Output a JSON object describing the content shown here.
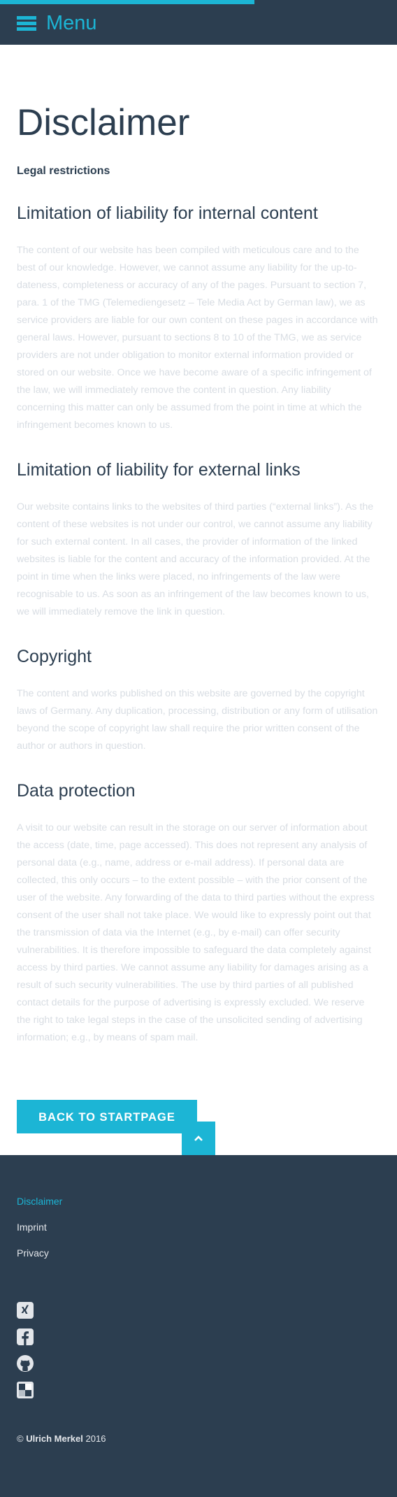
{
  "header": {
    "menu_label": "Menu",
    "menu_icon": "hamburger-icon",
    "accent_color": "#1cb5d5",
    "background_color": "#2c3e50"
  },
  "page": {
    "title": "Disclaimer",
    "subtitle": "Legal restrictions"
  },
  "sections": [
    {
      "heading": "Limitation of liability for internal content",
      "text": "The content of our website has been compiled with meticulous care and to the best of our knowledge. However, we cannot assume any liability for the up-to-dateness, completeness or accuracy of any of the pages. Pursuant to section 7, para. 1 of the TMG (Telemediengesetz – Tele Media Act by German law), we as service providers are liable for our own content on these pages in accordance with general laws. However, pursuant to sections 8 to 10 of the TMG, we as service providers are not under obligation to monitor external information provided or stored on our website. Once we have become aware of a specific infringement of the law, we will immediately remove the content in question. Any liability concerning this matter can only be assumed from the point in time at which the infringement becomes known to us."
    },
    {
      "heading": "Limitation of liability for external links",
      "text": "Our website contains links to the websites of third parties (“external links”). As the content of these websites is not under our control, we cannot assume any liability for such external content. In all cases, the provider of information of the linked websites is liable for the content and accuracy of the information provided. At the point in time when the links were placed, no infringements of the law were recognisable to us. As soon as an infringement of the law becomes known to us, we will immediately remove the link in question."
    },
    {
      "heading": "Copyright",
      "text": "The content and works published on this website are governed by the copyright laws of Germany. Any duplication, processing, distribution or any form of utilisation beyond the scope of copyright law shall require the prior written consent of the author or authors in question."
    },
    {
      "heading": "Data protection",
      "text": "A visit to our website can result in the storage on our server of information about the access (date, time, page accessed). This does not represent any analysis of personal data (e.g., name, address or e-mail address). If personal data are collected, this only occurs – to the extent possible – with the prior consent of the user of the website. Any forwarding of the data to third parties without the express consent of the user shall not take place. We would like to expressly point out that the transmission of data via the Internet (e.g., by e-mail) can offer security vulnerabilities. It is therefore impossible to safeguard the data completely against access by third parties. We cannot assume any liability for damages arising as a result of such security vulnerabilities. The use by third parties of all published contact details for the purpose of advertising is expressly excluded. We reserve the right to take legal steps in the case of the unsolicited sending of advertising information; e.g., by means of spam mail."
    }
  ],
  "back_button_label": "BACK TO STARTPAGE",
  "to_top_icon": "chevron-up-icon",
  "footer": {
    "links": [
      {
        "label": "Disclaimer",
        "active": true
      },
      {
        "label": "Imprint",
        "active": false
      },
      {
        "label": "Privacy",
        "active": false
      }
    ],
    "social_icons": [
      "xing-icon",
      "facebook-icon",
      "github-icon",
      "delicious-icon"
    ],
    "copyright_symbol": "©",
    "copyright_name": "Ulrich Merkel",
    "copyright_year": "2016"
  }
}
